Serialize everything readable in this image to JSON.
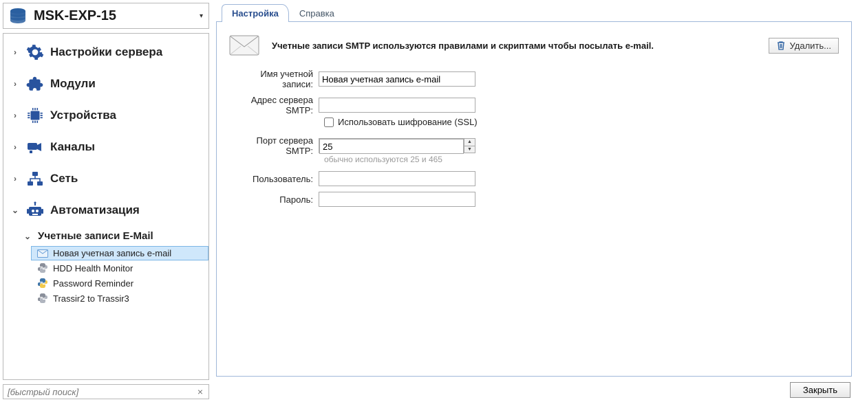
{
  "server": {
    "name": "MSK-EXP-15"
  },
  "sidebar": {
    "sections": [
      {
        "label": "Настройки сервера"
      },
      {
        "label": "Модули"
      },
      {
        "label": "Устройства"
      },
      {
        "label": "Каналы"
      },
      {
        "label": "Сеть"
      },
      {
        "label": "Автоматизация"
      }
    ],
    "automation_sub": {
      "label": "Учетные записи E-Mail"
    },
    "automation_leaves": [
      {
        "label": "Новая учетная запись e-mail",
        "icon": "mail",
        "selected": true
      },
      {
        "label": "HDD Health Monitor",
        "icon": "python"
      },
      {
        "label": "Password Reminder",
        "icon": "python"
      },
      {
        "label": "Trassir2 to Trassir3",
        "icon": "python"
      }
    ],
    "quick_search_placeholder": "[быстрый поиск]"
  },
  "tabs": {
    "settings": "Настройка",
    "help": "Справка"
  },
  "pane": {
    "info": "Учетные записи SMTP используются правилами и скриптами чтобы посылать e-mail.",
    "delete_btn": "Удалить...",
    "labels": {
      "account_name": "Имя учетной записи:",
      "smtp_server": "Адрес сервера SMTP:",
      "ssl": "Использовать шифрование (SSL)",
      "port": "Порт сервера SMTP:",
      "port_hint": "обычно используются 25 и 465",
      "user": "Пользователь:",
      "password": "Пароль:"
    },
    "values": {
      "account_name": "Новая учетная запись e-mail",
      "smtp_server": "",
      "ssl": false,
      "port": "25",
      "user": "",
      "password": ""
    }
  },
  "footer": {
    "close": "Закрыть"
  }
}
